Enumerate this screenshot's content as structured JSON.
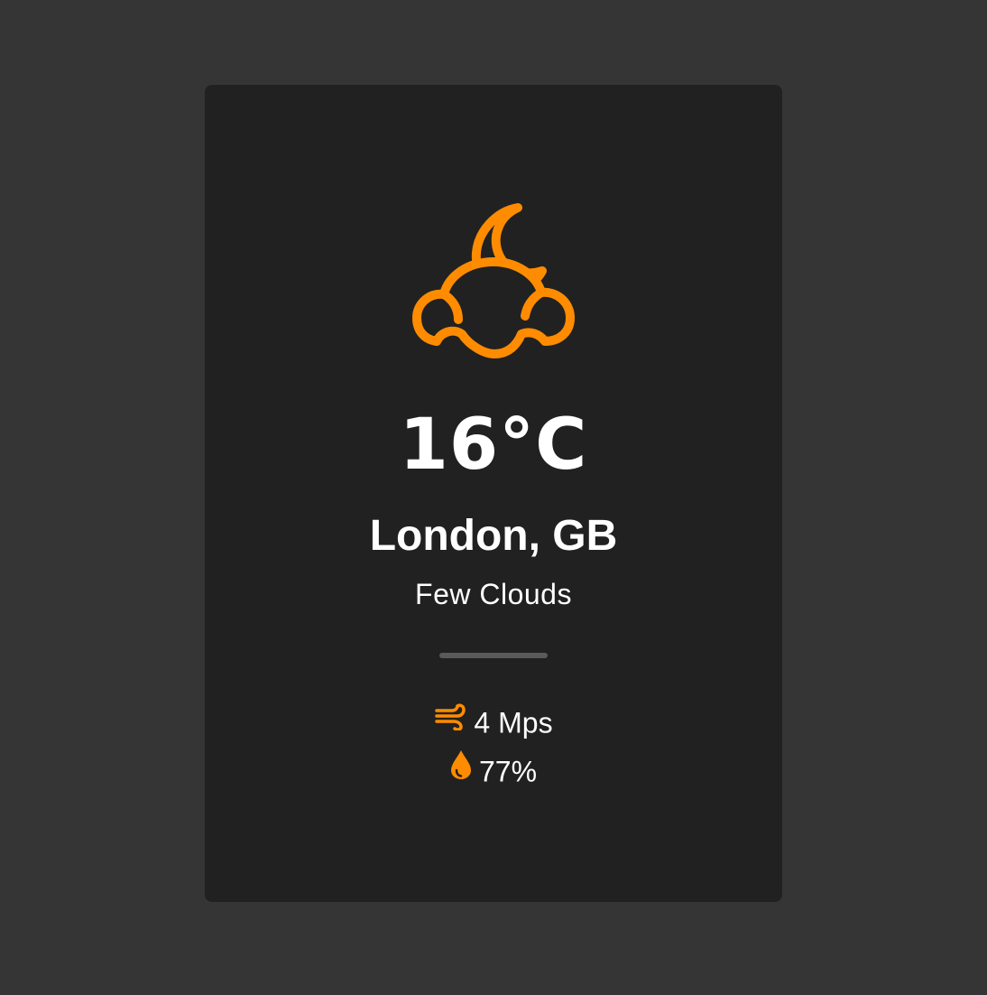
{
  "colors": {
    "background": "#353535",
    "card": "#212121",
    "accent": "#ff8c00",
    "text": "#ffffff",
    "divider": "#5a5a5a"
  },
  "weather": {
    "icon": "few-clouds-night-icon",
    "temperature": "16°C",
    "location": "London, GB",
    "description": "Few Clouds"
  },
  "stats": {
    "wind": {
      "icon": "wind-icon",
      "value": "4 Mps"
    },
    "humidity": {
      "icon": "humidity-drop-icon",
      "value": "77%"
    }
  }
}
